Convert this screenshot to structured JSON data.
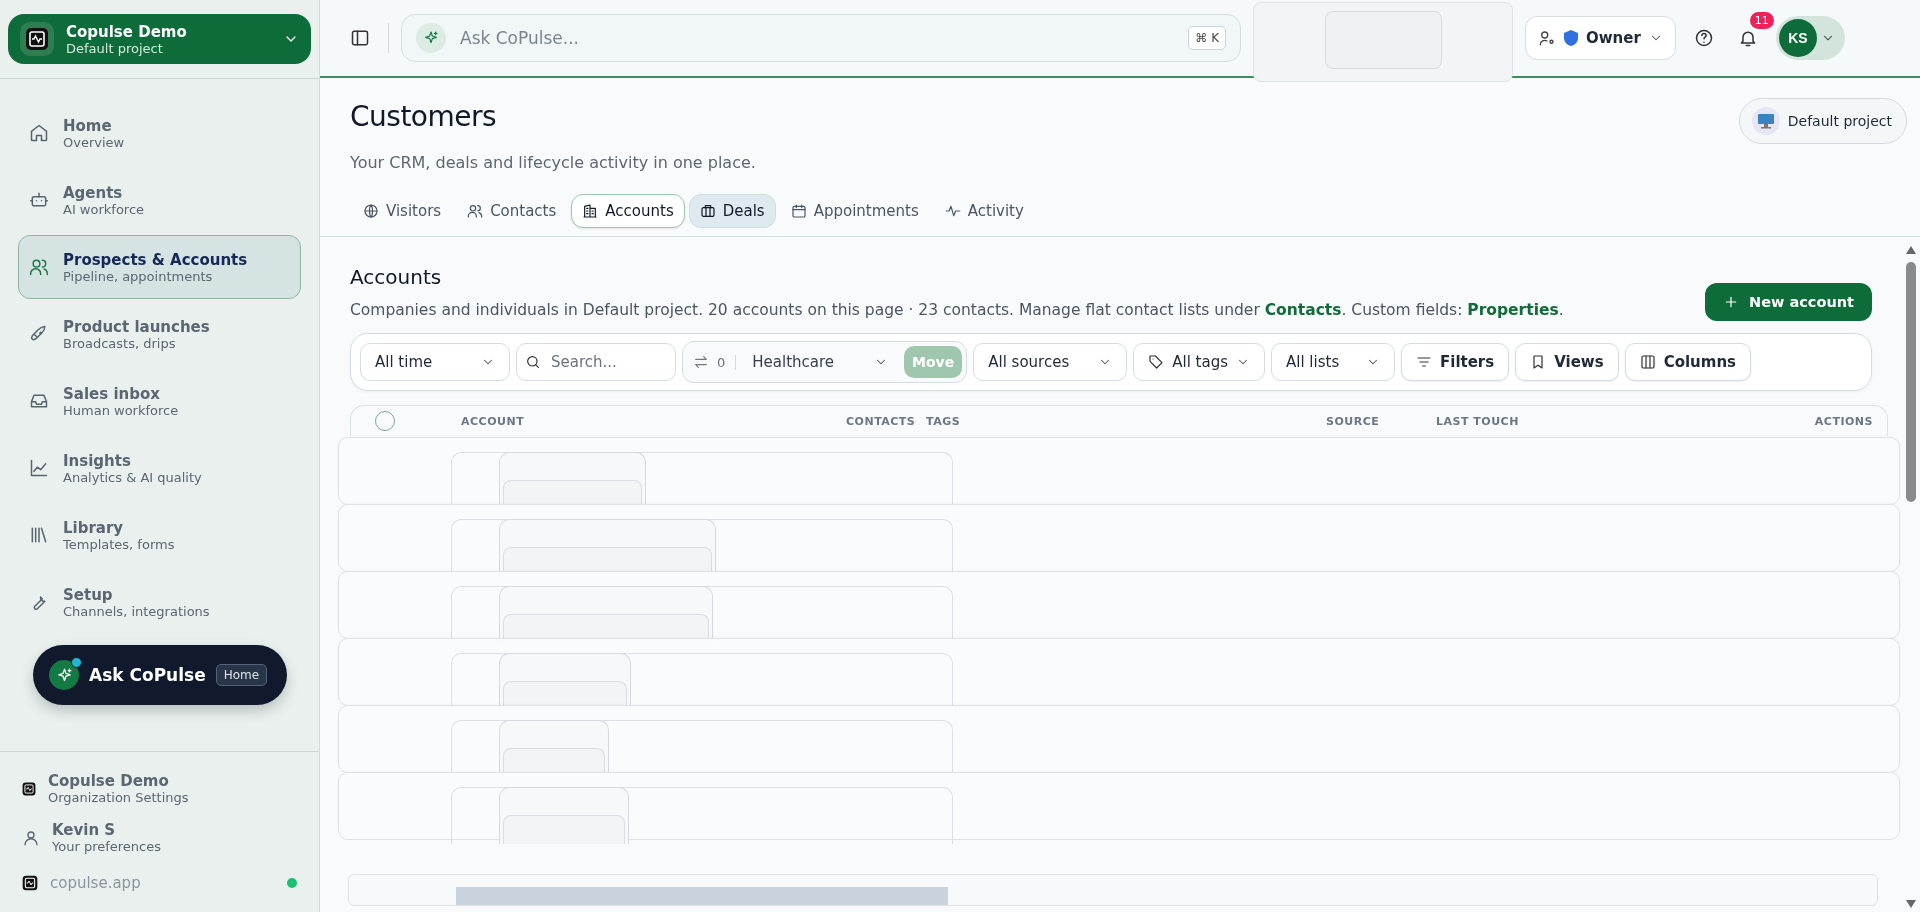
{
  "workspace": {
    "name": "Copulse Demo",
    "project": "Default project"
  },
  "nav": [
    {
      "title": "Home",
      "subtitle": "Overview",
      "selected": false
    },
    {
      "title": "Agents",
      "subtitle": "AI workforce",
      "selected": false
    },
    {
      "title": "Prospects & Accounts",
      "subtitle": "Pipeline, appointments",
      "selected": true
    },
    {
      "title": "Product launches",
      "subtitle": "Broadcasts, drips",
      "selected": false
    },
    {
      "title": "Sales inbox",
      "subtitle": "Human workforce",
      "selected": false
    },
    {
      "title": "Insights",
      "subtitle": "Analytics & AI quality",
      "selected": false
    },
    {
      "title": "Library",
      "subtitle": "Templates, forms",
      "selected": false
    },
    {
      "title": "Setup",
      "subtitle": "Channels, integrations",
      "selected": false
    }
  ],
  "ask_button": {
    "label": "Ask CoPulse",
    "context": "Home"
  },
  "footer": [
    {
      "title": "Copulse Demo",
      "subtitle": "Organization Settings"
    },
    {
      "title": "Kevin S",
      "subtitle": "Your preferences"
    }
  ],
  "site": {
    "label": "copulse.app",
    "online": true
  },
  "topbar": {
    "search_placeholder": "Ask CoPulse...",
    "shortcut": "⌘ K",
    "role": "Owner",
    "notifications": "11",
    "avatar": "KS"
  },
  "page": {
    "title": "Customers",
    "subtitle": "Your CRM, deals and lifecycle activity in one place.",
    "project_button": "Default project"
  },
  "tabs": [
    {
      "label": "Visitors",
      "selected": false,
      "highlighted": false
    },
    {
      "label": "Contacts",
      "selected": false,
      "highlighted": false
    },
    {
      "label": "Accounts",
      "selected": true,
      "highlighted": false
    },
    {
      "label": "Deals",
      "selected": false,
      "highlighted": true
    },
    {
      "label": "Appointments",
      "selected": false,
      "highlighted": false
    },
    {
      "label": "Activity",
      "selected": false,
      "highlighted": false
    }
  ],
  "section": {
    "title": "Accounts",
    "description_start": "Companies and individuals in Default project. 20 accounts on this page · 23 contacts. Manage flat contact lists under ",
    "link_1": "Contacts",
    "description_mid": ". Custom fields: ",
    "link_2": "Properties",
    "description_end": ".",
    "new_button": "New account"
  },
  "filters": [
    {
      "kind": "select",
      "label": "All time"
    },
    {
      "kind": "search",
      "placeholder": "Search..."
    },
    {
      "kind": "move",
      "count": "0",
      "value": "Healthcare",
      "button": "Move",
      "disabled": true
    },
    {
      "kind": "select",
      "label": "All sources"
    },
    {
      "kind": "tags",
      "label": "All tags"
    },
    {
      "kind": "select",
      "label": "All lists"
    },
    {
      "kind": "filters",
      "label": "Filters"
    },
    {
      "kind": "views",
      "label": "Views"
    },
    {
      "kind": "columns",
      "label": "Columns"
    }
  ],
  "table": {
    "all_checked": false,
    "columns": [
      "ACCOUNT",
      "CONTACTS",
      "TAGS",
      "SOURCE",
      "LAST TOUCH",
      "ACTIONS"
    ]
  }
}
